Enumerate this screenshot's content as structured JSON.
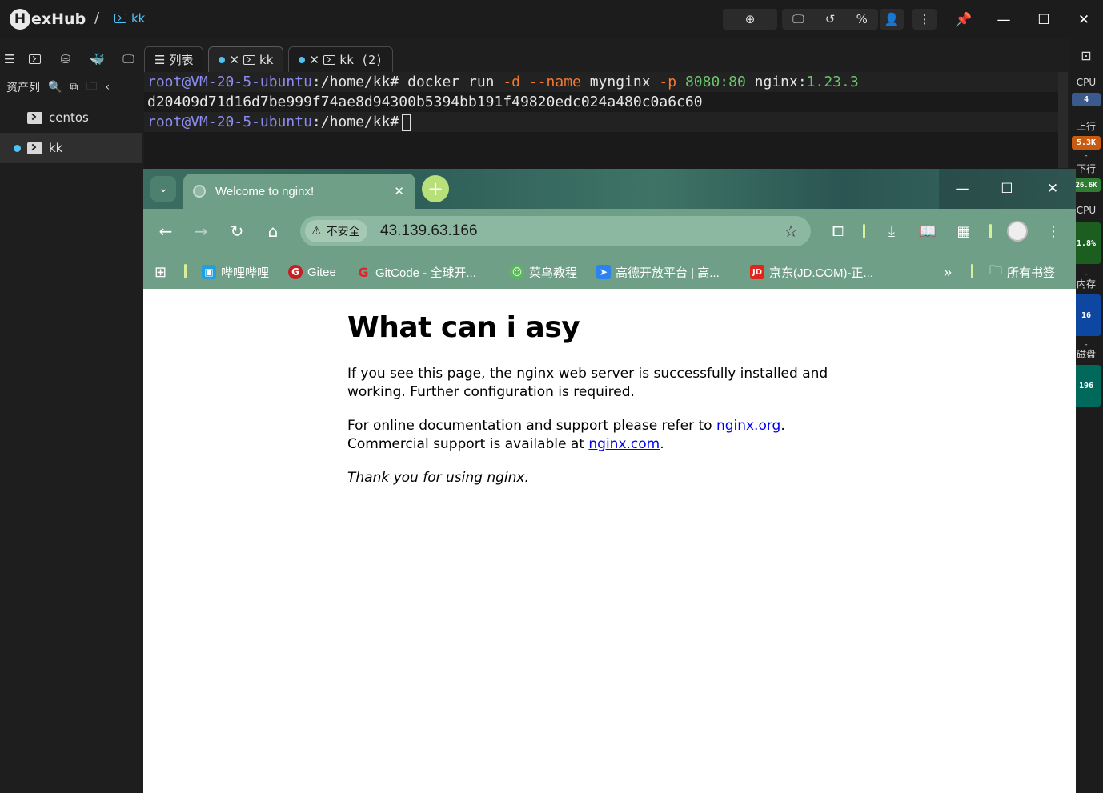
{
  "app": {
    "logo_letter": "H",
    "logo_text": "exHub",
    "breadcrumb_sep": "/",
    "breadcrumb": "kk"
  },
  "sidebar": {
    "header": "资产列",
    "items": [
      {
        "label": "centos"
      },
      {
        "label": "kk"
      }
    ]
  },
  "tabs": [
    {
      "label": "列表"
    },
    {
      "label": "kk"
    },
    {
      "label": "kk (2)"
    }
  ],
  "terminal": {
    "line1": {
      "prompt": "root@VM-20-5-ubuntu",
      "path": ":/home/kk#",
      "cmd1": " docker run ",
      "opt1": "-d",
      "opt2": " --name",
      "cmd2": " mynginx ",
      "opt3": "-p",
      "num1": " 8080:80",
      "cmd3": " nginx:",
      "num2": "1.23.3"
    },
    "line2": "d20409d71d16d7be999f74ae8d94300b5394bb191f49820edc024a480c0a6c60",
    "line3": {
      "prompt": "root@VM-20-5-ubuntu",
      "path": ":/home/kk#"
    }
  },
  "monitor": {
    "cpu_label": "CPU",
    "cpu_cores": "4",
    "up_label": "上行",
    "up_value": "5.3K",
    "down_label": "下行",
    "down_value": "26.6K",
    "cpu2_label": "CPU",
    "cpu_usage": "1.8%",
    "mem_label": "内存",
    "mem_value": "16",
    "disk_label": "磁盘",
    "disk_value": "196",
    "dash": "-"
  },
  "browser": {
    "tab_title": "Welcome to nginx!",
    "insecure_label": "不安全",
    "url": "43.139.63.166",
    "bookmarks": [
      {
        "label": "哔哩哔哩",
        "icon": "bilibili-icon",
        "color": "#20a0e0"
      },
      {
        "label": "Gitee",
        "icon": "gitee-icon",
        "color": "#c71d23"
      },
      {
        "label": "GitCode - 全球开...",
        "icon": "gitcode-icon",
        "color": "#e0242a"
      },
      {
        "label": "菜鸟教程",
        "icon": "runoob-icon",
        "color": "#5cb85c"
      },
      {
        "label": "高德开放平台 | 高...",
        "icon": "amap-icon",
        "color": "#2a83f0"
      },
      {
        "label": "京东(JD.COM)-正...",
        "icon": "jd-icon",
        "color": "#e1251b"
      }
    ],
    "all_bookmarks": "所有书签"
  },
  "page": {
    "heading": "What can i asy",
    "p1": "If you see this page, the nginx web server is successfully installed and working. Further configuration is required.",
    "p2_pre": "For online documentation and support please refer to ",
    "p2_link1": "nginx.org",
    "p2_mid": ".\nCommercial support is available at ",
    "p2_link2": "nginx.com",
    "p2_post": ".",
    "p3": "Thank you for using nginx."
  },
  "colors": {
    "accent": "#4fc3f7",
    "browser_theme": "#6fa087",
    "new_tab": "#b8e07a",
    "up_badge": "#c75b12",
    "down_badge": "#2e7d32",
    "cpu_badge": "#1b5e20",
    "mem_badge": "#0d47a1",
    "disk_badge": "#00695c"
  }
}
